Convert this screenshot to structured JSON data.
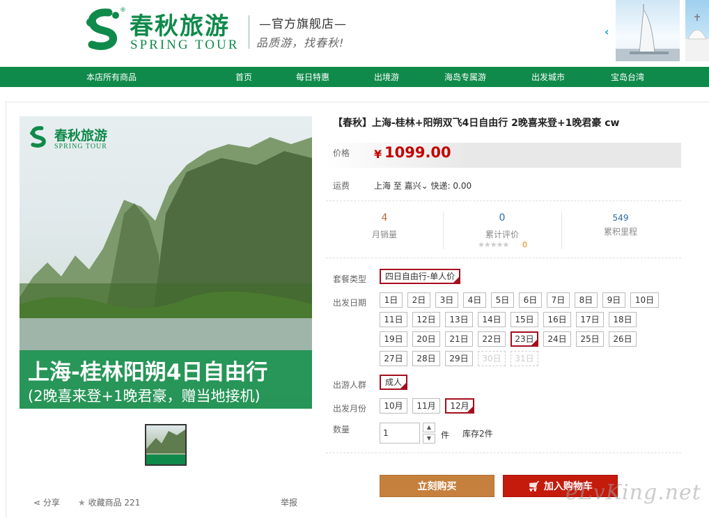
{
  "header": {
    "logo_cn": "春秋旅游",
    "logo_en": "SPRING TOUR",
    "logo_reg": "®",
    "flagship": "—官方旗舰店—",
    "slogan": "品质游，找春秋!",
    "banner_prev": "‹"
  },
  "nav": {
    "items": [
      "本店所有商品",
      "首页",
      "每日特惠",
      "出境游",
      "海岛专属游",
      "出发城市",
      "宝岛台湾"
    ]
  },
  "gallery": {
    "logo_cn": "春秋旅游",
    "logo_en": "SPRING TOUR",
    "title": "上海-桂林阳朔4日自由行",
    "subtitle": "(2晚喜来登+1晚君豪，赠当地接机)",
    "share": "分享",
    "collect_label": "收藏商品",
    "collect_count": "221",
    "report": "举报"
  },
  "product": {
    "title": "【春秋】上海-桂林+阳朔双飞4日自由行 2晚喜来登+1晚君豪 cw",
    "price_label": "价格",
    "currency": "¥",
    "price": "1099.00",
    "shipping_label": "运费",
    "shipping_from": "上海 至 嘉兴",
    "shipping_method": "快递: 0.00",
    "stats": {
      "monthly_sales": "4",
      "monthly_sales_label": "月销量",
      "reviews": "0",
      "reviews_label": "累计评价",
      "review_score": "0",
      "points": "549",
      "points_label": "累积里程"
    },
    "package_label": "套餐类型",
    "package_value": "四日自由行-单人价",
    "date_label": "出发日期",
    "dates": [
      "1日",
      "2日",
      "3日",
      "4日",
      "5日",
      "6日",
      "7日",
      "8日",
      "9日",
      "10日",
      "11日",
      "12日",
      "13日",
      "14日",
      "15日",
      "16日",
      "17日",
      "18日",
      "19日",
      "20日",
      "21日",
      "22日",
      "23日",
      "24日",
      "25日",
      "26日",
      "27日",
      "28日",
      "29日",
      "30日",
      "31日"
    ],
    "crowd_label": "出游人群",
    "crowd_value": "成人",
    "month_label": "出发月份",
    "months": [
      "10月",
      "11月",
      "12月"
    ],
    "qty_label": "数量",
    "qty_value": "1",
    "qty_unit": "件",
    "stock": "库存2件",
    "buy_button": "立刻购买",
    "cart_button": "加入购物车"
  },
  "colors": {
    "brand_green": "#0f8a4a",
    "price_red": "#c40000",
    "selected_border": "#a50d1e",
    "buy_bg": "#c6803e",
    "cart_bg": "#c41b0d"
  },
  "watermark": "eLvKing.net"
}
